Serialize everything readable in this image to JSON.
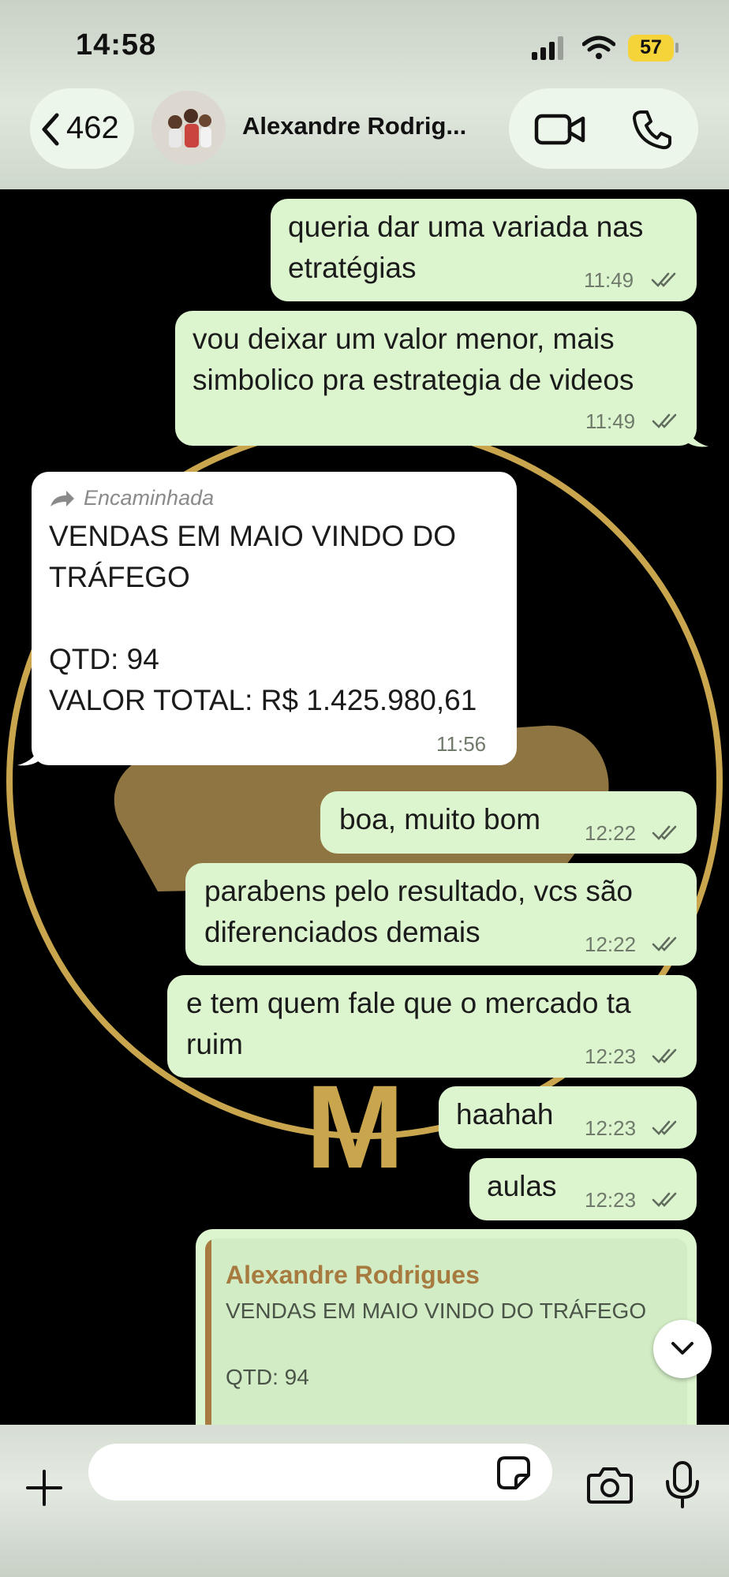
{
  "status_bar": {
    "time": "14:58",
    "battery": "57"
  },
  "header": {
    "back_count": "462",
    "contact_name": "Alexandre Rodrig...",
    "icons": [
      "back-chevron-icon",
      "avatar",
      "video-camera-icon",
      "phone-icon"
    ]
  },
  "messages": [
    {
      "dir": "out",
      "lines": [
        "queria dar uma variada nas",
        "etratégias"
      ],
      "time": "11:49",
      "read": true
    },
    {
      "dir": "out",
      "lines": [
        "vou deixar um valor menor, mais",
        "simbolico pra estrategia de videos"
      ],
      "time": "11:49",
      "read": true
    },
    {
      "dir": "in",
      "forwarded_label": "Encaminhada",
      "lines": [
        "VENDAS EM MAIO VINDO DO",
        "TRÁFEGO",
        "",
        "QTD: 94",
        "VALOR TOTAL: R$ 1.425.980,61"
      ],
      "time": "11:56"
    },
    {
      "dir": "out",
      "lines": [
        "boa, muito bom"
      ],
      "time": "12:22",
      "read": true
    },
    {
      "dir": "out",
      "lines": [
        "parabens pelo resultado, vcs são",
        "diferenciados demais"
      ],
      "time": "12:22",
      "read": true
    },
    {
      "dir": "out",
      "lines": [
        "e tem quem fale que o mercado ta",
        "ruim"
      ],
      "time": "12:23",
      "read": true
    },
    {
      "dir": "out",
      "lines": [
        "haahah"
      ],
      "time": "12:23",
      "read": true
    },
    {
      "dir": "out",
      "lines": [
        "aulas"
      ],
      "time": "12:23",
      "read": true
    }
  ],
  "quoted_reply": {
    "author": "Alexandre Rodrigues",
    "lines": [
      "VENDAS EM MAIO VINDO DO TRÁFEGO",
      "",
      "QTD: 94"
    ]
  },
  "wallpaper_letter": "M",
  "composer": {
    "placeholder": "",
    "icons": [
      "plus-icon",
      "sticker-icon",
      "camera-icon",
      "microphone-icon"
    ]
  },
  "colors": {
    "outgoing_bubble": "#ddf5cf",
    "incoming_bubble": "#ffffff",
    "read_ticks": "#5f6b5c",
    "quote_author": "#a77b3f",
    "wallpaper_gold": "#c8a24a"
  }
}
